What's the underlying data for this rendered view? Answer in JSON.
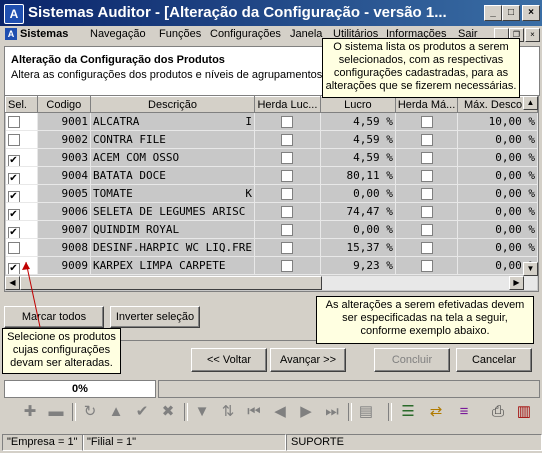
{
  "window": {
    "title": "Sistemas Auditor - [Alteração da Configuração - versão 1...",
    "icon": "A"
  },
  "menu": [
    "Sistemas",
    "Navegação",
    "Funções",
    "Configurações",
    "Janela",
    "Utilitários",
    "Informações",
    "Sair"
  ],
  "header": {
    "title": "Alteração da Configuração dos Produtos",
    "subtitle": "Altera as configurações dos produtos e níveis de agrupamentos."
  },
  "callouts": {
    "top": "O sistema lista os produtos a serem selecionados, com as respectivas configurações cadastradas, para as alterações que se fizerem necessárias.",
    "bottom_right": "As alterações a serem efetivadas devem ser especificadas na tela a seguir, conforme exemplo abaixo.",
    "bottom_left": "Selecione os produtos cujas configurações devam ser alteradas."
  },
  "table": {
    "columns": [
      "Sel.",
      "Codigo",
      "Descrição",
      "Herda Luc...",
      "Lucro",
      "Herda Má...",
      "Máx. Desco..."
    ],
    "rows": [
      {
        "sel": false,
        "codigo": "9001",
        "descricao": "ALCATRA",
        "extra": "I",
        "herda_lucro": false,
        "lucro": "4,59 %",
        "herda_max": false,
        "max_desc": "10,00 %"
      },
      {
        "sel": false,
        "codigo": "9002",
        "descricao": "CONTRA FILE",
        "extra": "",
        "herda_lucro": false,
        "lucro": "4,59 %",
        "herda_max": false,
        "max_desc": "0,00 %"
      },
      {
        "sel": true,
        "codigo": "9003",
        "descricao": "ACEM COM OSSO",
        "extra": "",
        "herda_lucro": false,
        "lucro": "4,59 %",
        "herda_max": false,
        "max_desc": "0,00 %"
      },
      {
        "sel": true,
        "codigo": "9004",
        "descricao": "BATATA DOCE",
        "extra": "",
        "herda_lucro": false,
        "lucro": "80,11 %",
        "herda_max": false,
        "max_desc": "0,00 %"
      },
      {
        "sel": true,
        "codigo": "9005",
        "descricao": "TOMATE",
        "extra": "K",
        "herda_lucro": false,
        "lucro": "0,00 %",
        "herda_max": false,
        "max_desc": "0,00 %"
      },
      {
        "sel": true,
        "codigo": "9006",
        "descricao": "SELETA DE LEGUMES ARISC",
        "extra": "",
        "herda_lucro": false,
        "lucro": "74,47 %",
        "herda_max": false,
        "max_desc": "0,00 %"
      },
      {
        "sel": true,
        "codigo": "9007",
        "descricao": "QUINDIM ROYAL",
        "extra": "",
        "herda_lucro": false,
        "lucro": "0,00 %",
        "herda_max": false,
        "max_desc": "0,00 %"
      },
      {
        "sel": false,
        "codigo": "9008",
        "descricao": "DESINF.HARPIC WC LIQ.FRE",
        "extra": "",
        "herda_lucro": false,
        "lucro": "15,37 %",
        "herda_max": false,
        "max_desc": "0,00 %"
      },
      {
        "sel": true,
        "codigo": "9009",
        "descricao": "KARPEX LIMPA CARPETE",
        "extra": "",
        "herda_lucro": false,
        "lucro": "9,23 %",
        "herda_max": false,
        "max_desc": "0,00 %"
      }
    ]
  },
  "buttons": {
    "marcar_todos": "Marcar todos",
    "inverter": "Inverter seleção",
    "voltar": "<< Voltar",
    "avancar": "Avançar >>",
    "concluir": "Concluir",
    "cancelar": "Cancelar"
  },
  "progress": {
    "label": "0%",
    "value": 0
  },
  "status": {
    "empresa": "\"Empresa = 1\"",
    "filial": "\"Filial = 1\"",
    "user": "SUPORTE"
  }
}
